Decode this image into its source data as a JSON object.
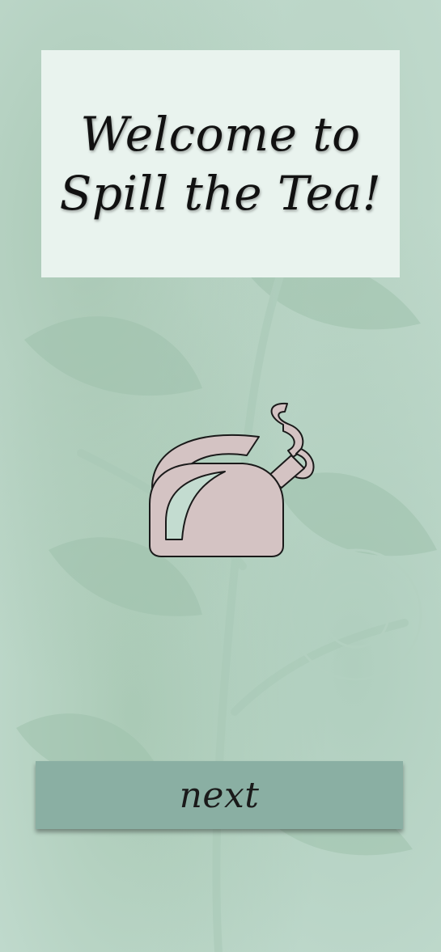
{
  "title": {
    "line1": "Welcome to",
    "line2": "Spill the Tea!"
  },
  "hero_icon": "kettle-steam-icon",
  "next_button": {
    "label": "next"
  },
  "colors": {
    "background": "#c3dcd0",
    "title_card": "#e9f3ee",
    "kettle_fill": "#d4c3c3",
    "button": "#8aafa3",
    "text": "#111111"
  }
}
